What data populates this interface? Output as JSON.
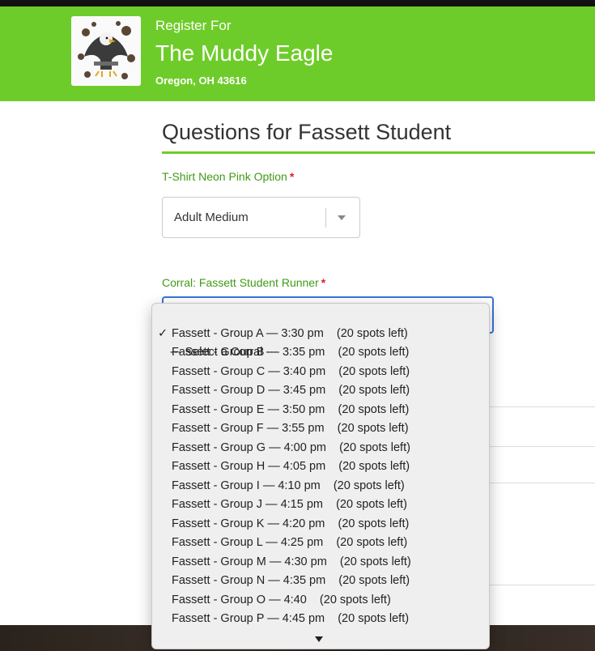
{
  "header": {
    "subtitle": "Register For",
    "title": "The Muddy Eagle",
    "location": "Oregon, OH 43616"
  },
  "section": {
    "title": "Questions for Fassett Student"
  },
  "tshirt": {
    "label": "T-Shirt Neon Pink Option",
    "required": "*",
    "selected": "Adult Medium"
  },
  "corral": {
    "label": "Corral: Fassett Student Runner",
    "required": "*",
    "checkmark": "✓",
    "options": [
      "--- Select a Corral ---",
      "Fassett - Group A — 3:30 pm    (20 spots left)",
      "Fassett - Group B — 3:35 pm    (20 spots left)",
      "Fassett - Group C — 3:40 pm    (20 spots left)",
      "Fassett - Group D — 3:45 pm    (20 spots left)",
      "Fassett - Group E — 3:50 pm    (20 spots left)",
      "Fassett - Group F — 3:55 pm    (20 spots left)",
      "Fassett - Group G — 4:00 pm    (20 spots left)",
      "Fassett - Group H — 4:05 pm    (20 spots left)",
      "Fassett - Group I — 4:10 pm    (20 spots left)",
      "Fassett - Group J — 4:15 pm    (20 spots left)",
      "Fassett - Group K — 4:20 pm    (20 spots left)",
      "Fassett - Group L — 4:25 pm    (20 spots left)",
      "Fassett - Group M — 4:30 pm    (20 spots left)",
      "Fassett - Group N — 4:35 pm    (20 spots left)",
      "Fassett - Group O — 4:40    (20 spots left)",
      "Fassett - Group P — 4:45 pm    (20 spots left)"
    ]
  },
  "colors": {
    "brand_green": "#6ecc2a",
    "label_green": "#3f9b15",
    "required_red": "#e02020",
    "focus_blue": "#3a73d6"
  },
  "icons": {
    "logo": "muddy-eagle-logo",
    "select_caret": "chevron-down-icon",
    "dropdown_scroll": "scroll-down-arrow-icon",
    "selected_check": "checkmark-icon"
  }
}
